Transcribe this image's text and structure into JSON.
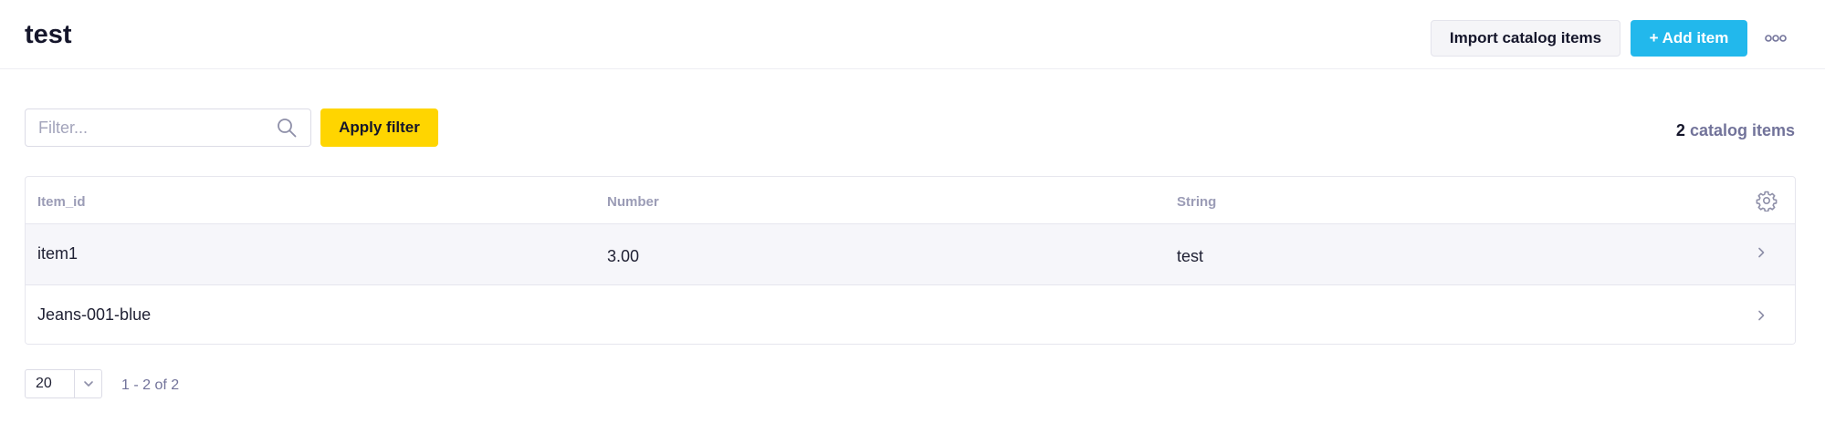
{
  "header": {
    "title": "test",
    "import_label": "Import catalog items",
    "add_label": "+ Add item",
    "more_icon": "more-horizontal-icon"
  },
  "filter": {
    "placeholder": "Filter...",
    "value": "",
    "apply_label": "Apply filter",
    "search_icon": "search-icon"
  },
  "summary": {
    "count": "2",
    "label": "catalog items"
  },
  "table": {
    "columns": [
      "Item_id",
      "Number",
      "String"
    ],
    "rows": [
      {
        "item_id": "item1",
        "number": "3.00",
        "string": "test"
      },
      {
        "item_id": "Jeans-001-blue",
        "number": "",
        "string": ""
      }
    ],
    "settings_icon": "gear-icon",
    "row_icon": "chevron-right-icon"
  },
  "pagination": {
    "page_size": "20",
    "range": "1 - 2 of 2"
  },
  "colors": {
    "primary": "#22b8ec",
    "accent": "#ffd500",
    "muted": "#72739a"
  }
}
